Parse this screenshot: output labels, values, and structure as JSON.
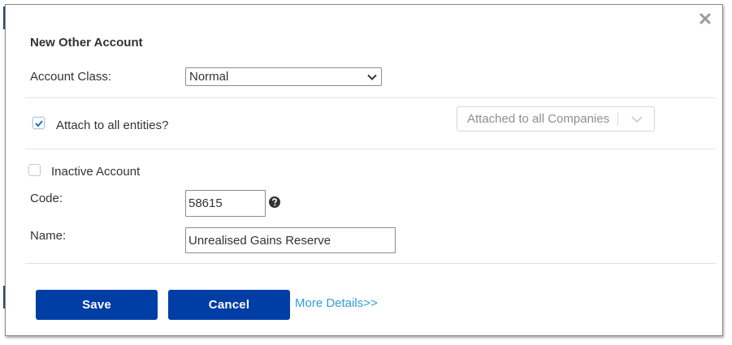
{
  "dialog": {
    "title": "New Other Account",
    "account_class": {
      "label": "Account Class:",
      "selected": "Normal"
    },
    "attach_entities": {
      "label": "Attach to all entities?",
      "checked": true
    },
    "entity_select": {
      "value": "Attached to all Companies"
    },
    "inactive": {
      "label": "Inactive Account",
      "checked": false
    },
    "code": {
      "label": "Code:",
      "value": "58615"
    },
    "name": {
      "label": "Name:",
      "value": "Unrealised Gains Reserve"
    },
    "buttons": {
      "save": "Save",
      "cancel": "Cancel"
    },
    "more_details": "More Details>>"
  },
  "colors": {
    "primary_button": "#003da5",
    "link": "#2f9fd8",
    "check": "#1f6fd0"
  }
}
